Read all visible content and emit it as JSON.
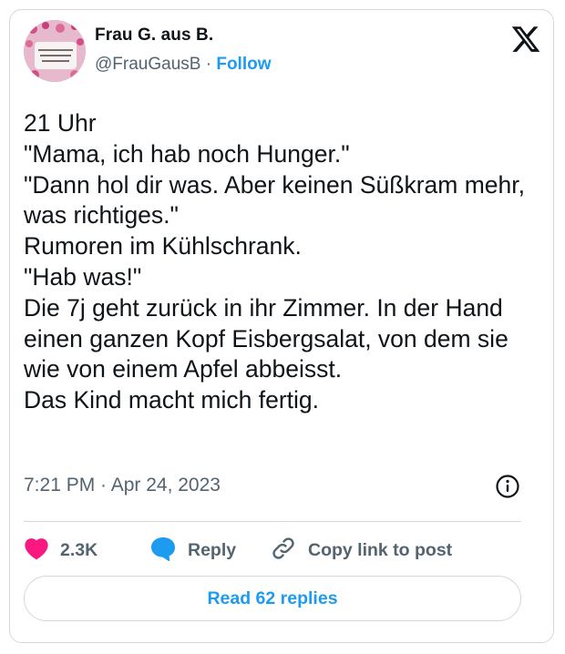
{
  "author": {
    "name": "Frau G. aus B.",
    "handle": "@FrauGausB",
    "separator": " · ",
    "follow_label": "Follow"
  },
  "tweet": {
    "text": "21 Uhr\n\"Mama, ich hab noch Hunger.\"\n\"Dann hol dir was. Aber keinen Süßkram mehr, was richtiges.\"\nRumoren im Kühlschrank.\n\"Hab was!\"\nDie 7j geht zurück in ihr Zimmer. In der Hand einen ganzen Kopf Eisbergsalat, von dem sie wie von einem Apfel abbeisst.\nDas Kind macht mich fertig.",
    "timestamp": "7:21 PM · Apr 24, 2023"
  },
  "actions": {
    "likes": "2.3K",
    "reply_label": "Reply",
    "copy_label": "Copy link to post"
  },
  "read_replies_label": "Read 62 replies",
  "icons": {
    "platform": "x-logo-icon",
    "info": "info-icon",
    "like": "heart-icon",
    "reply": "speech-bubble-icon",
    "copy": "link-icon"
  },
  "colors": {
    "accent": "#1d9bf0",
    "heart": "#f91880",
    "text": "#0f1419",
    "muted": "#536471",
    "border": "#cfd9de"
  }
}
